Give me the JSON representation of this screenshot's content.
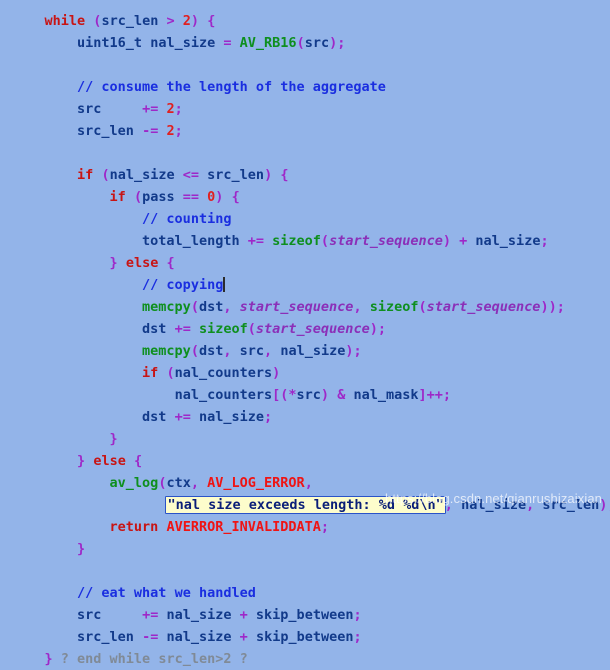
{
  "editor": {
    "background_color": "#93b4e9",
    "language": "C",
    "font_style": "monospace-bold",
    "caret_line_index": 10,
    "caret_after_text": "// copying"
  },
  "palette": {
    "keyword": "#c81414",
    "type": "#123a8a",
    "variable": "#123a8a",
    "operator": "#9e28c8",
    "number": "#e02020",
    "function": "#0e8f1e",
    "constant": "#ef1414",
    "comment": "#1a2ee0",
    "italic_param": "#8b2fb8",
    "fold_marker": "#808a96",
    "string_text": "#0a1e78",
    "string_highlight_bg": "#fdfdcc",
    "string_highlight_border": "#2a53c8"
  },
  "lines": [
    {
      "index": 0,
      "text": "    while (src_len > 2) {",
      "tokens": [
        {
          "t": "    ",
          "c": "t-plain"
        },
        {
          "t": "while",
          "c": "t-kw"
        },
        {
          "t": " ",
          "c": "t-plain"
        },
        {
          "t": "(",
          "c": "t-op"
        },
        {
          "t": "src_len",
          "c": "t-var"
        },
        {
          "t": " ",
          "c": "t-plain"
        },
        {
          "t": ">",
          "c": "t-op"
        },
        {
          "t": " ",
          "c": "t-plain"
        },
        {
          "t": "2",
          "c": "t-num"
        },
        {
          "t": ")",
          "c": "t-op"
        },
        {
          "t": " ",
          "c": "t-plain"
        },
        {
          "t": "{",
          "c": "t-op"
        }
      ]
    },
    {
      "index": 1,
      "text": "        uint16_t nal_size = AV_RB16(src);",
      "tokens": [
        {
          "t": "        ",
          "c": "t-plain"
        },
        {
          "t": "uint16_t",
          "c": "t-type"
        },
        {
          "t": " ",
          "c": "t-plain"
        },
        {
          "t": "nal_size",
          "c": "t-var"
        },
        {
          "t": " ",
          "c": "t-plain"
        },
        {
          "t": "=",
          "c": "t-op"
        },
        {
          "t": " ",
          "c": "t-plain"
        },
        {
          "t": "AV_RB16",
          "c": "t-fn"
        },
        {
          "t": "(",
          "c": "t-op"
        },
        {
          "t": "src",
          "c": "t-var"
        },
        {
          "t": ")",
          "c": "t-op"
        },
        {
          "t": ";",
          "c": "t-op"
        }
      ]
    },
    {
      "index": 2,
      "text": "",
      "tokens": []
    },
    {
      "index": 3,
      "text": "        // consume the length of the aggregate",
      "tokens": [
        {
          "t": "        ",
          "c": "t-plain"
        },
        {
          "t": "// consume the length of the aggregate",
          "c": "t-cmt"
        }
      ]
    },
    {
      "index": 4,
      "text": "        src     += 2;",
      "tokens": [
        {
          "t": "        ",
          "c": "t-plain"
        },
        {
          "t": "src",
          "c": "t-var"
        },
        {
          "t": "     ",
          "c": "t-plain"
        },
        {
          "t": "+=",
          "c": "t-op"
        },
        {
          "t": " ",
          "c": "t-plain"
        },
        {
          "t": "2",
          "c": "t-num"
        },
        {
          "t": ";",
          "c": "t-op"
        }
      ]
    },
    {
      "index": 5,
      "text": "        src_len -= 2;",
      "tokens": [
        {
          "t": "        ",
          "c": "t-plain"
        },
        {
          "t": "src_len",
          "c": "t-var"
        },
        {
          "t": " ",
          "c": "t-plain"
        },
        {
          "t": "-=",
          "c": "t-op"
        },
        {
          "t": " ",
          "c": "t-plain"
        },
        {
          "t": "2",
          "c": "t-num"
        },
        {
          "t": ";",
          "c": "t-op"
        }
      ]
    },
    {
      "index": 6,
      "text": "",
      "tokens": []
    },
    {
      "index": 7,
      "text": "        if (nal_size <= src_len) {",
      "tokens": [
        {
          "t": "        ",
          "c": "t-plain"
        },
        {
          "t": "if",
          "c": "t-kw"
        },
        {
          "t": " ",
          "c": "t-plain"
        },
        {
          "t": "(",
          "c": "t-op"
        },
        {
          "t": "nal_size",
          "c": "t-var"
        },
        {
          "t": " ",
          "c": "t-plain"
        },
        {
          "t": "<=",
          "c": "t-op"
        },
        {
          "t": " ",
          "c": "t-plain"
        },
        {
          "t": "src_len",
          "c": "t-var"
        },
        {
          "t": ")",
          "c": "t-op"
        },
        {
          "t": " ",
          "c": "t-plain"
        },
        {
          "t": "{",
          "c": "t-op"
        }
      ]
    },
    {
      "index": 8,
      "text": "            if (pass == 0) {",
      "tokens": [
        {
          "t": "            ",
          "c": "t-plain"
        },
        {
          "t": "if",
          "c": "t-kw"
        },
        {
          "t": " ",
          "c": "t-plain"
        },
        {
          "t": "(",
          "c": "t-op"
        },
        {
          "t": "pass",
          "c": "t-var"
        },
        {
          "t": " ",
          "c": "t-plain"
        },
        {
          "t": "==",
          "c": "t-op"
        },
        {
          "t": " ",
          "c": "t-plain"
        },
        {
          "t": "0",
          "c": "t-num"
        },
        {
          "t": ")",
          "c": "t-op"
        },
        {
          "t": " ",
          "c": "t-plain"
        },
        {
          "t": "{",
          "c": "t-op"
        }
      ]
    },
    {
      "index": 9,
      "text": "                // counting",
      "tokens": [
        {
          "t": "                ",
          "c": "t-plain"
        },
        {
          "t": "// counting",
          "c": "t-cmt"
        }
      ]
    },
    {
      "index": 10,
      "text": "                total_length += sizeof(start_sequence) + nal_size;",
      "tokens": [
        {
          "t": "                ",
          "c": "t-plain"
        },
        {
          "t": "total_length",
          "c": "t-var"
        },
        {
          "t": " ",
          "c": "t-plain"
        },
        {
          "t": "+=",
          "c": "t-op"
        },
        {
          "t": " ",
          "c": "t-plain"
        },
        {
          "t": "sizeof",
          "c": "t-fn"
        },
        {
          "t": "(",
          "c": "t-op"
        },
        {
          "t": "start_sequence",
          "c": "t-italic"
        },
        {
          "t": ")",
          "c": "t-op"
        },
        {
          "t": " ",
          "c": "t-plain"
        },
        {
          "t": "+",
          "c": "t-op"
        },
        {
          "t": " ",
          "c": "t-plain"
        },
        {
          "t": "nal_size",
          "c": "t-var"
        },
        {
          "t": ";",
          "c": "t-op"
        }
      ]
    },
    {
      "index": 11,
      "text": "            } else {",
      "tokens": [
        {
          "t": "            ",
          "c": "t-plain"
        },
        {
          "t": "}",
          "c": "t-op"
        },
        {
          "t": " ",
          "c": "t-plain"
        },
        {
          "t": "else",
          "c": "t-kw"
        },
        {
          "t": " ",
          "c": "t-plain"
        },
        {
          "t": "{",
          "c": "t-op"
        }
      ]
    },
    {
      "index": 12,
      "text": "                // copying",
      "has_caret": true,
      "tokens": [
        {
          "t": "                ",
          "c": "t-plain"
        },
        {
          "t": "// copying",
          "c": "t-cmt"
        }
      ]
    },
    {
      "index": 13,
      "text": "                memcpy(dst, start_sequence, sizeof(start_sequence));",
      "tokens": [
        {
          "t": "                ",
          "c": "t-plain"
        },
        {
          "t": "memcpy",
          "c": "t-fn"
        },
        {
          "t": "(",
          "c": "t-op"
        },
        {
          "t": "dst",
          "c": "t-var"
        },
        {
          "t": ",",
          "c": "t-op"
        },
        {
          "t": " ",
          "c": "t-plain"
        },
        {
          "t": "start_sequence",
          "c": "t-italic"
        },
        {
          "t": ",",
          "c": "t-op"
        },
        {
          "t": " ",
          "c": "t-plain"
        },
        {
          "t": "sizeof",
          "c": "t-fn"
        },
        {
          "t": "(",
          "c": "t-op"
        },
        {
          "t": "start_sequence",
          "c": "t-italic"
        },
        {
          "t": ")",
          "c": "t-op"
        },
        {
          "t": ")",
          "c": "t-op"
        },
        {
          "t": ";",
          "c": "t-op"
        }
      ]
    },
    {
      "index": 14,
      "text": "                dst += sizeof(start_sequence);",
      "tokens": [
        {
          "t": "                ",
          "c": "t-plain"
        },
        {
          "t": "dst",
          "c": "t-var"
        },
        {
          "t": " ",
          "c": "t-plain"
        },
        {
          "t": "+=",
          "c": "t-op"
        },
        {
          "t": " ",
          "c": "t-plain"
        },
        {
          "t": "sizeof",
          "c": "t-fn"
        },
        {
          "t": "(",
          "c": "t-op"
        },
        {
          "t": "start_sequence",
          "c": "t-italic"
        },
        {
          "t": ")",
          "c": "t-op"
        },
        {
          "t": ";",
          "c": "t-op"
        }
      ]
    },
    {
      "index": 15,
      "text": "                memcpy(dst, src, nal_size);",
      "tokens": [
        {
          "t": "                ",
          "c": "t-plain"
        },
        {
          "t": "memcpy",
          "c": "t-fn"
        },
        {
          "t": "(",
          "c": "t-op"
        },
        {
          "t": "dst",
          "c": "t-var"
        },
        {
          "t": ",",
          "c": "t-op"
        },
        {
          "t": " ",
          "c": "t-plain"
        },
        {
          "t": "src",
          "c": "t-var"
        },
        {
          "t": ",",
          "c": "t-op"
        },
        {
          "t": " ",
          "c": "t-plain"
        },
        {
          "t": "nal_size",
          "c": "t-var"
        },
        {
          "t": ")",
          "c": "t-op"
        },
        {
          "t": ";",
          "c": "t-op"
        }
      ]
    },
    {
      "index": 16,
      "text": "                if (nal_counters)",
      "tokens": [
        {
          "t": "                ",
          "c": "t-plain"
        },
        {
          "t": "if",
          "c": "t-kw"
        },
        {
          "t": " ",
          "c": "t-plain"
        },
        {
          "t": "(",
          "c": "t-op"
        },
        {
          "t": "nal_counters",
          "c": "t-var"
        },
        {
          "t": ")",
          "c": "t-op"
        }
      ]
    },
    {
      "index": 17,
      "text": "                    nal_counters[(*src) & nal_mask]++;",
      "tokens": [
        {
          "t": "                    ",
          "c": "t-plain"
        },
        {
          "t": "nal_counters",
          "c": "t-var"
        },
        {
          "t": "[",
          "c": "t-op"
        },
        {
          "t": "(",
          "c": "t-op"
        },
        {
          "t": "*",
          "c": "t-op"
        },
        {
          "t": "src",
          "c": "t-var"
        },
        {
          "t": ")",
          "c": "t-op"
        },
        {
          "t": " ",
          "c": "t-plain"
        },
        {
          "t": "&",
          "c": "t-op"
        },
        {
          "t": " ",
          "c": "t-plain"
        },
        {
          "t": "nal_mask",
          "c": "t-var"
        },
        {
          "t": "]",
          "c": "t-op"
        },
        {
          "t": "++",
          "c": "t-op"
        },
        {
          "t": ";",
          "c": "t-op"
        }
      ]
    },
    {
      "index": 18,
      "text": "                dst += nal_size;",
      "tokens": [
        {
          "t": "                ",
          "c": "t-plain"
        },
        {
          "t": "dst",
          "c": "t-var"
        },
        {
          "t": " ",
          "c": "t-plain"
        },
        {
          "t": "+=",
          "c": "t-op"
        },
        {
          "t": " ",
          "c": "t-plain"
        },
        {
          "t": "nal_size",
          "c": "t-var"
        },
        {
          "t": ";",
          "c": "t-op"
        }
      ]
    },
    {
      "index": 19,
      "text": "            }",
      "tokens": [
        {
          "t": "            ",
          "c": "t-plain"
        },
        {
          "t": "}",
          "c": "t-op"
        }
      ]
    },
    {
      "index": 20,
      "text": "        } else {",
      "tokens": [
        {
          "t": "        ",
          "c": "t-plain"
        },
        {
          "t": "}",
          "c": "t-op"
        },
        {
          "t": " ",
          "c": "t-plain"
        },
        {
          "t": "else",
          "c": "t-kw"
        },
        {
          "t": " ",
          "c": "t-plain"
        },
        {
          "t": "{",
          "c": "t-op"
        }
      ]
    },
    {
      "index": 21,
      "text": "            av_log(ctx, AV_LOG_ERROR,",
      "tokens": [
        {
          "t": "            ",
          "c": "t-plain"
        },
        {
          "t": "av_log",
          "c": "t-fn"
        },
        {
          "t": "(",
          "c": "t-op"
        },
        {
          "t": "ctx",
          "c": "t-var"
        },
        {
          "t": ",",
          "c": "t-op"
        },
        {
          "t": " ",
          "c": "t-plain"
        },
        {
          "t": "AV_LOG_ERROR",
          "c": "t-const"
        },
        {
          "t": ",",
          "c": "t-op"
        }
      ]
    },
    {
      "index": 22,
      "text": "                   \"nal size exceeds length: %d %d\\n\", nal_size, src_len);",
      "tokens": [
        {
          "t": "                   ",
          "c": "t-plain"
        },
        {
          "t": "\"nal size exceeds length: %d %d\\n\"",
          "c": "hl-string",
          "highlight": true
        },
        {
          "t": ",",
          "c": "t-op"
        },
        {
          "t": " ",
          "c": "t-plain"
        },
        {
          "t": "nal_size",
          "c": "t-var"
        },
        {
          "t": ",",
          "c": "t-op"
        },
        {
          "t": " ",
          "c": "t-plain"
        },
        {
          "t": "src_len",
          "c": "t-var"
        },
        {
          "t": ")",
          "c": "t-op"
        },
        {
          "t": ";",
          "c": "t-op"
        }
      ]
    },
    {
      "index": 23,
      "text": "            return AVERROR_INVALIDDATA;",
      "tokens": [
        {
          "t": "            ",
          "c": "t-plain"
        },
        {
          "t": "return",
          "c": "t-kw"
        },
        {
          "t": " ",
          "c": "t-plain"
        },
        {
          "t": "AVERROR_INVALIDDATA",
          "c": "t-const"
        },
        {
          "t": ";",
          "c": "t-op"
        }
      ]
    },
    {
      "index": 24,
      "text": "        }",
      "tokens": [
        {
          "t": "        ",
          "c": "t-plain"
        },
        {
          "t": "}",
          "c": "t-op"
        }
      ]
    },
    {
      "index": 25,
      "text": "",
      "tokens": []
    },
    {
      "index": 26,
      "text": "        // eat what we handled",
      "tokens": [
        {
          "t": "        ",
          "c": "t-plain"
        },
        {
          "t": "// eat what we handled",
          "c": "t-cmt"
        }
      ]
    },
    {
      "index": 27,
      "text": "        src     += nal_size + skip_between;",
      "tokens": [
        {
          "t": "        ",
          "c": "t-plain"
        },
        {
          "t": "src",
          "c": "t-var"
        },
        {
          "t": "     ",
          "c": "t-plain"
        },
        {
          "t": "+=",
          "c": "t-op"
        },
        {
          "t": " ",
          "c": "t-plain"
        },
        {
          "t": "nal_size",
          "c": "t-var"
        },
        {
          "t": " ",
          "c": "t-plain"
        },
        {
          "t": "+",
          "c": "t-op"
        },
        {
          "t": " ",
          "c": "t-plain"
        },
        {
          "t": "skip_between",
          "c": "t-var"
        },
        {
          "t": ";",
          "c": "t-op"
        }
      ]
    },
    {
      "index": 28,
      "text": "        src_len -= nal_size + skip_between;",
      "tokens": [
        {
          "t": "        ",
          "c": "t-plain"
        },
        {
          "t": "src_len",
          "c": "t-var"
        },
        {
          "t": " ",
          "c": "t-plain"
        },
        {
          "t": "-=",
          "c": "t-op"
        },
        {
          "t": " ",
          "c": "t-plain"
        },
        {
          "t": "nal_size",
          "c": "t-var"
        },
        {
          "t": " ",
          "c": "t-plain"
        },
        {
          "t": "+",
          "c": "t-op"
        },
        {
          "t": " ",
          "c": "t-plain"
        },
        {
          "t": "skip_between",
          "c": "t-var"
        },
        {
          "t": ";",
          "c": "t-op"
        }
      ]
    },
    {
      "index": 29,
      "text": "    } ? end while src_len>2 ?",
      "tokens": [
        {
          "t": "    ",
          "c": "t-plain"
        },
        {
          "t": "}",
          "c": "t-op"
        },
        {
          "t": " ? end while src_len>2 ?",
          "c": "t-fold"
        }
      ]
    }
  ],
  "watermark": {
    "text": "https://blog.csdn.net/qianrushizaixian"
  }
}
